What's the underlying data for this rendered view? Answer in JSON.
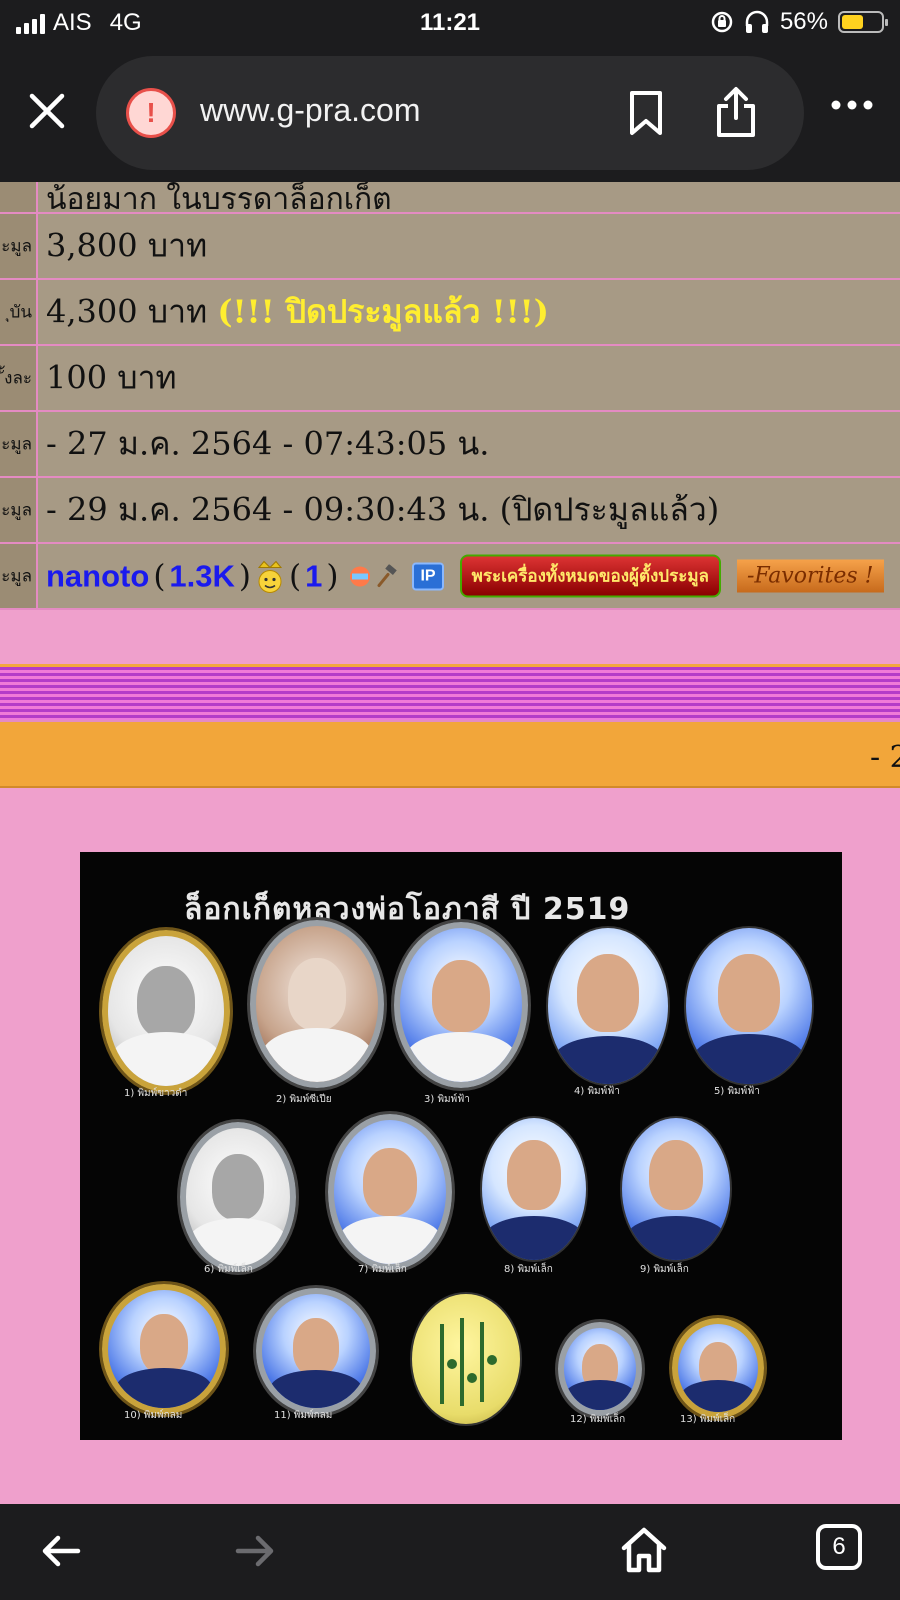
{
  "status_bar": {
    "carrier": "AIS",
    "network": "4G",
    "time": "11:21",
    "battery_percent": "56%",
    "battery_level": 0.56
  },
  "browser": {
    "url": "www.g-pra.com",
    "warning_icon": "!",
    "icons": [
      "close-icon",
      "warning-icon",
      "bookmark-icon",
      "share-icon",
      "more-icon"
    ]
  },
  "auction_table": {
    "rows": [
      {
        "label": "",
        "value": "น้อยมาก ในบรรดาล็อกเก็ต"
      },
      {
        "label": "ะมูล",
        "value": "3,800 บาท"
      },
      {
        "label": "ุบัน",
        "value": "4,300 บาท",
        "note": "(!!! ปิดประมูลแล้ว !!!)"
      },
      {
        "label": "ั้งละ",
        "value": "100 บาท"
      },
      {
        "label": "ะมูล",
        "value": "- 27 ม.ค. 2564 - 07:43:05 น."
      },
      {
        "label": "ะมูล",
        "value": "- 29 ม.ค. 2564 - 09:30:43 น. (ปิดประมูลแล้ว)"
      }
    ],
    "seller": {
      "label": "ะมูล",
      "open_paren": "(",
      "close_paren": ")",
      "name": "nanoto",
      "score": "1.3K",
      "badge_count": "1",
      "ip_label": "IP",
      "all_items_button": "พระเครื่องทั้งหมดของผู้ตั้งประมูล",
      "favorites_button": "-Favorites !"
    }
  },
  "orange_bar": {
    "text": "- 2"
  },
  "photo": {
    "title": "ล็อกเก็ตหลวงพ่อโอภาสี ปี 2519",
    "captions": [
      "1) พิมพ์ขาวดำ",
      "2) พิมพ์ซีเปีย",
      "3) พิมพ์ฟ้า",
      "4) พิมพ์ฟ้า",
      "5) พิมพ์ฟ้า",
      "6) พิมพ์เล็ก",
      "7) พิมพ์เล็ก",
      "8) พิมพ์เล็ก",
      "9) พิมพ์เล็ก",
      "10) พิมพ์กลม",
      "11) พิมพ์กลม",
      "12) พิมพ์เล็ก",
      "13) พิมพ์เล็ก"
    ]
  },
  "bottom_nav": {
    "tab_count": "6",
    "icons": [
      "back-icon",
      "forward-icon",
      "home-icon",
      "tabs-icon"
    ]
  }
}
